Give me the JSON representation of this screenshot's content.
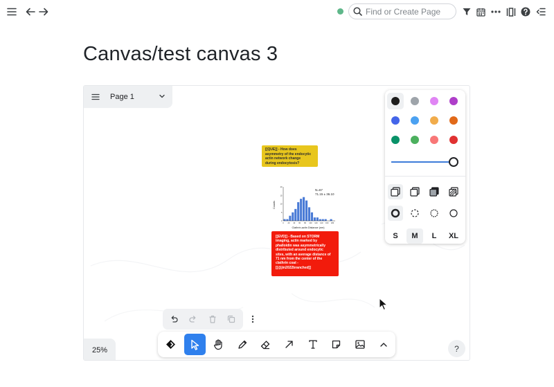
{
  "topbar": {
    "menu_icon": "hamburger-menu-icon",
    "back_icon": "arrow-left-icon",
    "forward_icon": "arrow-right-icon",
    "status_color": "#5fb78a",
    "search_placeholder": "Find or Create Page",
    "actions": [
      "filter-icon",
      "calendar-icon",
      "more-horizontal-icon",
      "columns-icon",
      "help-circle-icon",
      "sidebar-toggle-icon"
    ]
  },
  "page": {
    "title": "Canvas/test canvas 3"
  },
  "canvas": {
    "page_selector": {
      "label": "Page 1"
    },
    "zoom_label": "25%",
    "help_label": "?",
    "note_question": "[[QUE]] - How does\nasymmetry of the endocytic\nactin network change\nduring endocytosis?",
    "note_evidence": "[[EVD]] - Based on STORM\nimaging, actin marked by\nphalloidin was asymmetrically\ndistributed around endocytic\nsites, with an average distance of\n71 nm from the center of the\nclathrin coat -\n[[@jin2022branched]]",
    "histogram": {
      "annotation_n": "N=67",
      "annotation_mean": "71.15 ± 36.10",
      "xlabel": "Clathrin-actin Distance (nm)",
      "ylabel": "Counts"
    }
  },
  "chart_data": {
    "type": "bar",
    "title": "",
    "xlabel": "Clathrin-actin Distance (nm)",
    "ylabel": "Counts",
    "categories": [
      "0",
      "10",
      "20",
      "30",
      "40",
      "50",
      "60",
      "70",
      "80",
      "90",
      "100",
      "110",
      "120",
      "130",
      "140",
      "150",
      "160",
      "170",
      "180"
    ],
    "values": [
      1,
      1,
      3,
      5,
      7,
      11,
      13,
      14,
      12,
      8,
      5,
      2,
      2,
      1,
      1,
      1,
      0,
      1,
      0
    ],
    "x_ticks": [
      "0",
      "20",
      "40",
      "60",
      "80",
      "100",
      "120",
      "140",
      "160",
      "180"
    ],
    "y_ticks": [
      "0",
      "5",
      "10",
      "15",
      "20"
    ],
    "ylim": [
      0,
      20
    ],
    "color": "#4a7bd6",
    "annotations": [
      "N=67",
      "71.15 ± 36.10"
    ]
  },
  "style_panel": {
    "colors": [
      {
        "name": "black",
        "hex": "#1d1d1d",
        "selected": true
      },
      {
        "name": "grey",
        "hex": "#9ea4aa"
      },
      {
        "name": "light-violet",
        "hex": "#e085f4"
      },
      {
        "name": "violet",
        "hex": "#ae3ec9"
      },
      {
        "name": "blue",
        "hex": "#4465e9"
      },
      {
        "name": "light-blue",
        "hex": "#4ba1f1"
      },
      {
        "name": "yellow",
        "hex": "#f1ac4b"
      },
      {
        "name": "orange",
        "hex": "#e16919"
      },
      {
        "name": "green",
        "hex": "#099268"
      },
      {
        "name": "light-green",
        "hex": "#4cb05e"
      },
      {
        "name": "light-red",
        "hex": "#f87777"
      },
      {
        "name": "red",
        "hex": "#e03131"
      }
    ],
    "opacity": 1.0,
    "fill_styles": [
      "fill-none-icon",
      "fill-semi-icon",
      "fill-solid-icon",
      "fill-pattern-icon"
    ],
    "dash_styles": [
      "dash-draw-icon",
      "dash-dashed-icon",
      "dash-dotted-icon",
      "dash-solid-icon"
    ],
    "sizes": [
      "S",
      "M",
      "L",
      "XL"
    ],
    "selected_size": "M"
  },
  "action_bar": [
    "undo-icon",
    "redo-icon",
    "delete-icon",
    "duplicate-icon",
    "more-vertical-icon"
  ],
  "toolbar": {
    "tools": [
      "logo-icon",
      "select-icon",
      "hand-icon",
      "draw-icon",
      "eraser-icon",
      "arrow-icon",
      "text-icon",
      "note-icon",
      "image-icon",
      "chevron-up-icon"
    ],
    "active_tool": "select-icon"
  }
}
